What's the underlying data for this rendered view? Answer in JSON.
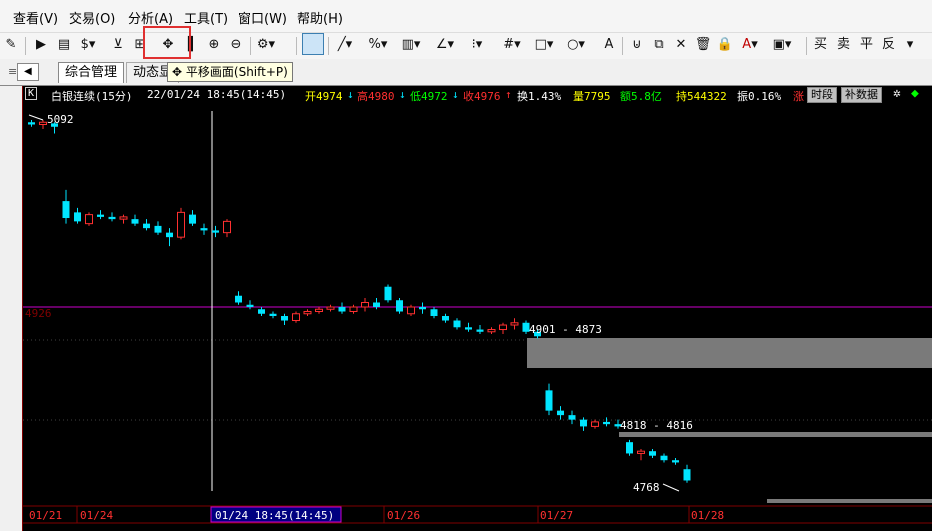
{
  "menu": [
    "查看(V)",
    "交易(O)",
    "分析(A)",
    "工具(T)",
    "窗口(W)",
    "帮助(H)"
  ],
  "toolbar": {
    "buy": "买",
    "sell": "卖",
    "flat": "平",
    "reverse": "反",
    "tooltip": "平移画面(Shift+P)"
  },
  "tabs": [
    "综合管理",
    "动态显"
  ],
  "header": {
    "symbol_box": "K",
    "title": "白银连续(15分)",
    "datetime": "22/01/24  18:45(14:45)",
    "open": "开4974",
    "open_arrow": "↓",
    "high": "高4980",
    "high_arrow": "↓",
    "low": "低4972",
    "low_arrow": "↓",
    "close": "收4976",
    "close_arrow": "↑",
    "turnover": "换1.43%",
    "volume": "量7795",
    "amount": "额5.8亿",
    "position": "持544322",
    "amplitude": "振0.16%",
    "rise": "涨",
    "btn_period": "时段",
    "btn_data": "补数据"
  },
  "chart_data": {
    "type": "candlestick",
    "price_labels": [
      "5092",
      "4926",
      "4901 - 4873",
      "4818 - 4816",
      "4768"
    ],
    "date_labels": [
      "01/21",
      "01/24",
      "01/24  18:45(14:45)",
      "01/26",
      "01/27",
      "01/28"
    ],
    "reference_line": 4926,
    "gaps": [
      {
        "label": "4901 - 4873"
      },
      {
        "label": "4818 - 4816"
      }
    ],
    "candles": [
      [
        5090,
        5092,
        5086,
        5088
      ],
      [
        5088,
        5092,
        5084,
        5090
      ],
      [
        5089,
        5090,
        5080,
        5086
      ],
      [
        5020,
        5030,
        5000,
        5005
      ],
      [
        5010,
        5014,
        5000,
        5002
      ],
      [
        5000,
        5010,
        4998,
        5008
      ],
      [
        5008,
        5012,
        5004,
        5006
      ],
      [
        5006,
        5010,
        5002,
        5004
      ],
      [
        5004,
        5008,
        5000,
        5006
      ],
      [
        5004,
        5008,
        4998,
        5000
      ],
      [
        5000,
        5004,
        4994,
        4996
      ],
      [
        4998,
        5002,
        4990,
        4992
      ],
      [
        4992,
        4996,
        4980,
        4988
      ],
      [
        4988,
        5014,
        4986,
        5010
      ],
      [
        5008,
        5012,
        4998,
        5000
      ],
      [
        4996,
        5000,
        4990,
        4994
      ],
      [
        4994,
        4998,
        4988,
        4992
      ],
      [
        4992,
        5004,
        4988,
        5002
      ],
      [
        4936,
        4940,
        4928,
        4930
      ],
      [
        4928,
        4932,
        4924,
        4926
      ],
      [
        4924,
        4926,
        4918,
        4920
      ],
      [
        4920,
        4922,
        4916,
        4918
      ],
      [
        4918,
        4920,
        4910,
        4914
      ],
      [
        4914,
        4922,
        4912,
        4920
      ],
      [
        4920,
        4924,
        4918,
        4922
      ],
      [
        4922,
        4926,
        4920,
        4924
      ],
      [
        4924,
        4928,
        4922,
        4926
      ],
      [
        4926,
        4930,
        4920,
        4922
      ],
      [
        4922,
        4928,
        4920,
        4926
      ],
      [
        4926,
        4934,
        4922,
        4930
      ],
      [
        4930,
        4934,
        4924,
        4926
      ],
      [
        4944,
        4946,
        4930,
        4932
      ],
      [
        4932,
        4934,
        4920,
        4922
      ],
      [
        4920,
        4928,
        4918,
        4926
      ],
      [
        4926,
        4930,
        4920,
        4924
      ],
      [
        4924,
        4926,
        4916,
        4918
      ],
      [
        4918,
        4920,
        4912,
        4914
      ],
      [
        4914,
        4916,
        4906,
        4908
      ],
      [
        4908,
        4912,
        4904,
        4906
      ],
      [
        4906,
        4910,
        4902,
        4904
      ],
      [
        4904,
        4908,
        4902,
        4906
      ],
      [
        4906,
        4912,
        4902,
        4910
      ],
      [
        4910,
        4916,
        4906,
        4912
      ],
      [
        4912,
        4914,
        4902,
        4904
      ],
      [
        4904,
        4906,
        4898,
        4900
      ],
      [
        4852,
        4858,
        4830,
        4834
      ],
      [
        4834,
        4838,
        4826,
        4830
      ],
      [
        4830,
        4834,
        4822,
        4826
      ],
      [
        4826,
        4828,
        4816,
        4820
      ],
      [
        4820,
        4826,
        4818,
        4824
      ],
      [
        4824,
        4828,
        4820,
        4822
      ],
      [
        4822,
        4826,
        4818,
        4820
      ],
      [
        4806,
        4808,
        4794,
        4796
      ],
      [
        4796,
        4800,
        4790,
        4798
      ],
      [
        4798,
        4800,
        4792,
        4794
      ],
      [
        4794,
        4796,
        4788,
        4790
      ],
      [
        4790,
        4792,
        4786,
        4788
      ],
      [
        4782,
        4786,
        4770,
        4772
      ]
    ]
  }
}
